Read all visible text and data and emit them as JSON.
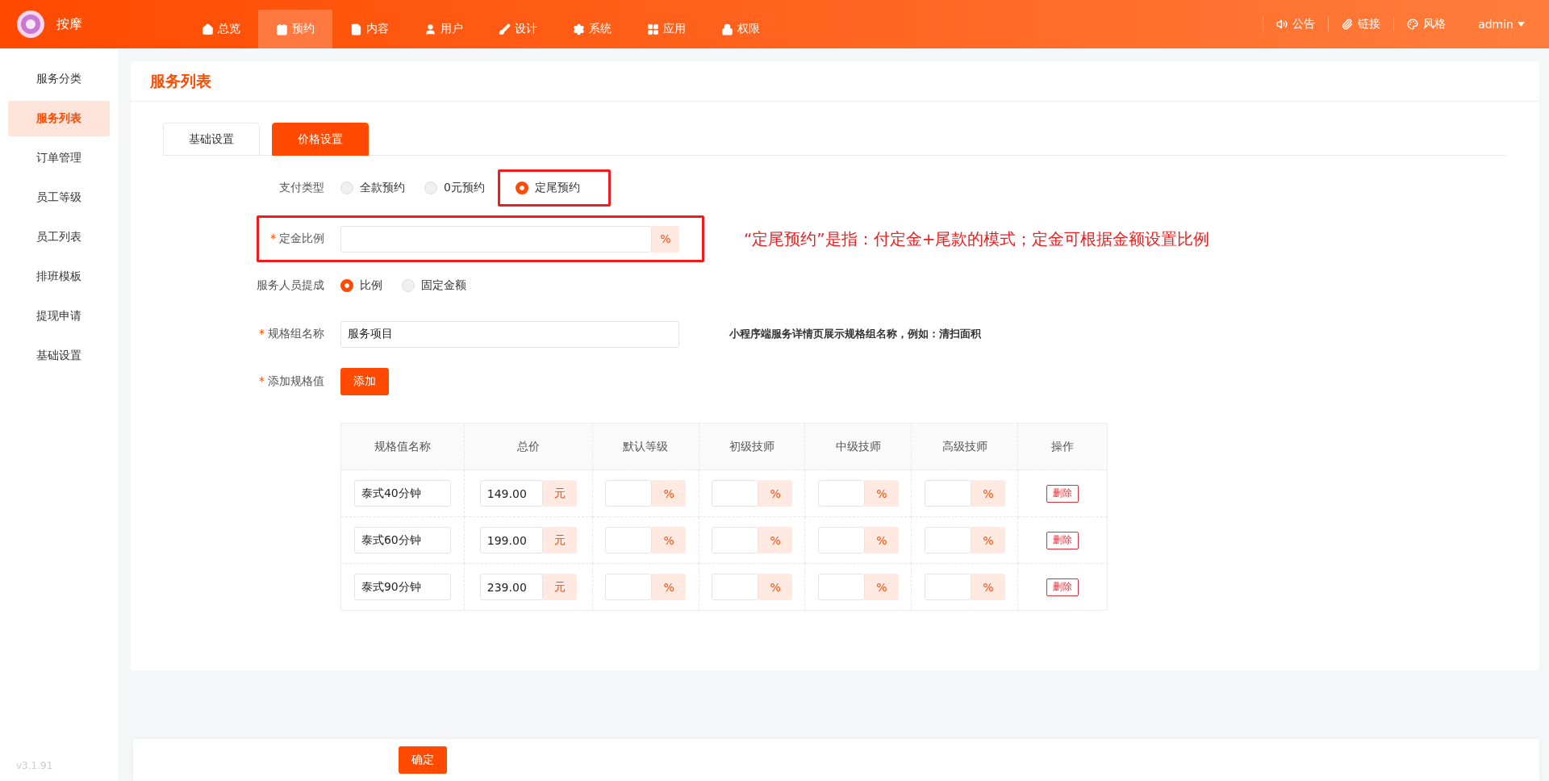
{
  "app": {
    "name": "按摩",
    "version": "v3.1.91"
  },
  "nav": [
    {
      "label": "总览",
      "selected": false
    },
    {
      "label": "预约",
      "selected": true
    },
    {
      "label": "内容",
      "selected": false
    },
    {
      "label": "用户",
      "selected": false
    },
    {
      "label": "设计",
      "selected": false
    },
    {
      "label": "系统",
      "selected": false
    },
    {
      "label": "应用",
      "selected": false
    },
    {
      "label": "权限",
      "selected": false
    }
  ],
  "top_links": [
    {
      "label": "公告"
    },
    {
      "label": "链接"
    },
    {
      "label": "风格"
    }
  ],
  "user": {
    "name": "admin"
  },
  "sidebar": [
    {
      "label": "服务分类",
      "selected": false
    },
    {
      "label": "服务列表",
      "selected": true
    },
    {
      "label": "订单管理",
      "selected": false
    },
    {
      "label": "员工等级",
      "selected": false
    },
    {
      "label": "员工列表",
      "selected": false
    },
    {
      "label": "排班模板",
      "selected": false
    },
    {
      "label": "提现申请",
      "selected": false
    },
    {
      "label": "基础设置",
      "selected": false
    }
  ],
  "page": {
    "title": "服务列表"
  },
  "tabs": [
    {
      "label": "基础设置",
      "selected": false
    },
    {
      "label": "价格设置",
      "selected": true
    }
  ],
  "form": {
    "payment_type": {
      "label": "支付类型",
      "options": [
        {
          "label": "全款预约",
          "selected": false,
          "highlighted": false
        },
        {
          "label": "0元预约",
          "selected": false,
          "highlighted": false
        },
        {
          "label": "定尾预约",
          "selected": true,
          "highlighted": true
        }
      ]
    },
    "deposit": {
      "label": "定金比例",
      "required_mark": "*",
      "suffix": "%",
      "highlighted": true
    },
    "note": "“定尾预约”是指：付定金+尾款的模式；定金可根据金额设置比例",
    "commission": {
      "label": "服务人员提成",
      "options": [
        {
          "label": "比例",
          "selected": true,
          "highlighted": false
        },
        {
          "label": "固定金额",
          "selected": false,
          "highlighted": false
        }
      ]
    },
    "spec_group": {
      "label": "规格组名称",
      "required_mark": "*",
      "value": "服务项目",
      "hint": "小程序端服务详情页展示规格组名称，例如：清扫面积"
    },
    "add_spec": {
      "label": "添加规格值",
      "required_mark": "*",
      "button": "添加"
    }
  },
  "spec_table": {
    "columns": [
      "规格值名称",
      "总价",
      "默认等级",
      "初级技师",
      "中级技师",
      "高级技师",
      "操作"
    ],
    "rows": [
      {
        "name": "泰式40分钟",
        "price": "149.00",
        "price_unit": "元",
        "rate_suffixes": [
          "%",
          "%",
          "%",
          "%"
        ],
        "action": "删除"
      },
      {
        "name": "泰式60分钟",
        "price": "199.00",
        "price_unit": "元",
        "rate_suffixes": [
          "%",
          "%",
          "%",
          "%"
        ],
        "action": "删除"
      },
      {
        "name": "泰式90分钟",
        "price": "239.00",
        "price_unit": "元",
        "rate_suffixes": [
          "%",
          "%",
          "%",
          "%"
        ],
        "action": "删除"
      }
    ]
  },
  "submit": "确定"
}
